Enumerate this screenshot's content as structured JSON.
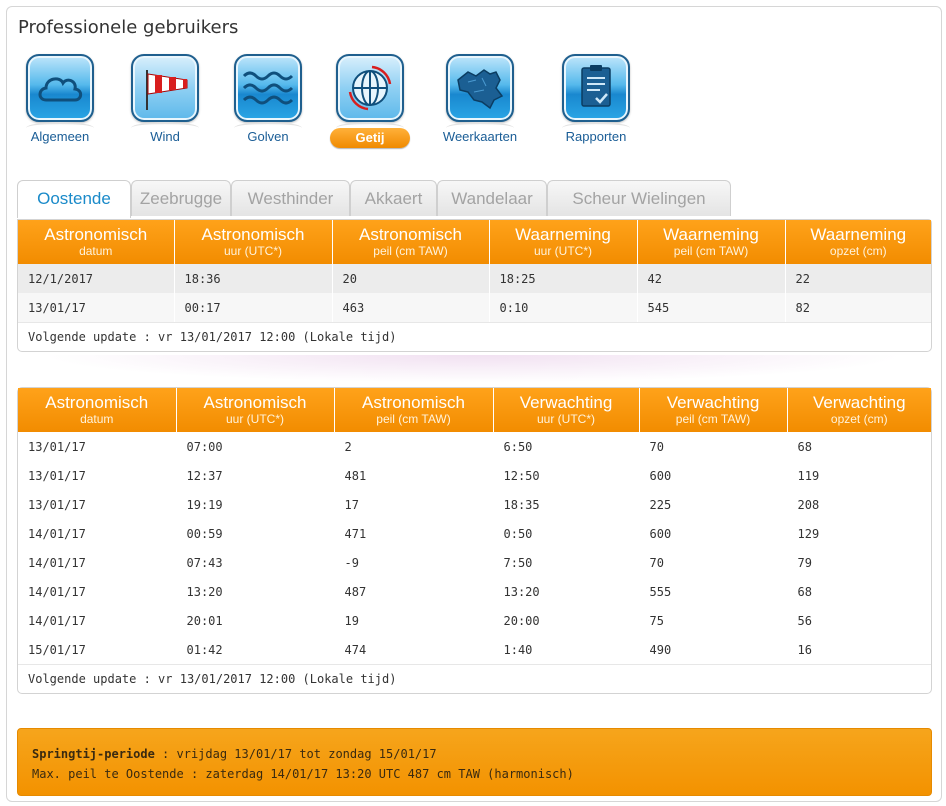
{
  "page_title": "Professionele gebruikers",
  "nav": [
    {
      "label": "Algemeen",
      "icon": "cloud-icon",
      "active": false
    },
    {
      "label": "Wind",
      "icon": "windsock-icon",
      "active": false
    },
    {
      "label": "Golven",
      "icon": "waves-icon",
      "active": false
    },
    {
      "label": "Getij",
      "icon": "globe-tide-icon",
      "active": true
    },
    {
      "label": "Weerkaarten",
      "icon": "belgium-map-icon",
      "active": false
    },
    {
      "label": "Rapporten",
      "icon": "report-icon",
      "active": false
    }
  ],
  "tabs": [
    "Oostende",
    "Zeebrugge",
    "Westhinder",
    "Akkaert",
    "Wandelaar",
    "Scheur Wielingen"
  ],
  "active_tab": "Oostende",
  "observations": {
    "headers": [
      {
        "title": "Astronomisch",
        "sub": "datum"
      },
      {
        "title": "Astronomisch",
        "sub": "uur (UTC*)"
      },
      {
        "title": "Astronomisch",
        "sub": "peil (cm TAW)"
      },
      {
        "title": "Waarneming",
        "sub": "uur (UTC*)"
      },
      {
        "title": "Waarneming",
        "sub": "peil (cm TAW)"
      },
      {
        "title": "Waarneming",
        "sub": "opzet (cm)"
      }
    ],
    "rows": [
      [
        "12/1/2017",
        "18:36",
        "20",
        "18:25",
        "42",
        "22"
      ],
      [
        "13/01/17",
        "00:17",
        "463",
        "0:10",
        "545",
        "82"
      ]
    ],
    "update": "Volgende update : vr 13/01/2017 12:00 (Lokale tijd)"
  },
  "forecast": {
    "headers": [
      {
        "title": "Astronomisch",
        "sub": "datum"
      },
      {
        "title": "Astronomisch",
        "sub": "uur (UTC*)"
      },
      {
        "title": "Astronomisch",
        "sub": "peil (cm TAW)"
      },
      {
        "title": "Verwachting",
        "sub": "uur (UTC*)"
      },
      {
        "title": "Verwachting",
        "sub": "peil (cm TAW)"
      },
      {
        "title": "Verwachting",
        "sub": "opzet (cm)"
      }
    ],
    "rows": [
      [
        "13/01/17",
        "07:00",
        "2",
        "6:50",
        "70",
        "68"
      ],
      [
        "13/01/17",
        "12:37",
        "481",
        "12:50",
        "600",
        "119"
      ],
      [
        "13/01/17",
        "19:19",
        "17",
        "18:35",
        "225",
        "208"
      ],
      [
        "14/01/17",
        "00:59",
        "471",
        "0:50",
        "600",
        "129"
      ],
      [
        "14/01/17",
        "07:43",
        "-9",
        "7:50",
        "70",
        "79"
      ],
      [
        "14/01/17",
        "13:20",
        "487",
        "13:20",
        "555",
        "68"
      ],
      [
        "14/01/17",
        "20:01",
        "19",
        "20:00",
        "75",
        "56"
      ],
      [
        "15/01/17",
        "01:42",
        "474",
        "1:40",
        "490",
        "16"
      ]
    ],
    "update": "Volgende update : vr 13/01/2017 12:00 (Lokale tijd)"
  },
  "info": {
    "label": "Springtij-periode",
    "line1_rest": " : vrijdag 13/01/17 tot zondag 15/01/17",
    "line2": "Max. peil te Oostende : zaterdag 14/01/17 13:20 UTC 487 cm TAW (harmonisch)"
  },
  "colors": {
    "accent_orange": "#f39200",
    "nav_blue": "#1a5d96",
    "tab_active": "#1a8ac9"
  }
}
